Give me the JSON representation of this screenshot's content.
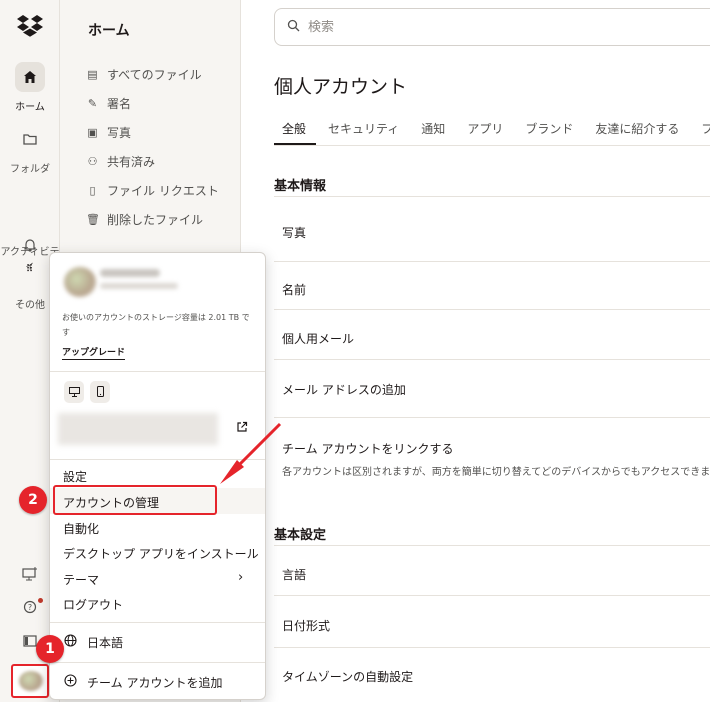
{
  "rail": {
    "items": [
      {
        "label": "ホーム",
        "icon": "home-icon",
        "active": true
      },
      {
        "label": "フォルダ",
        "icon": "folder-icon"
      },
      {
        "label": "アクティビテ\nィ",
        "icon": "bell-icon"
      },
      {
        "label": "その他",
        "icon": "grid-icon"
      }
    ],
    "bottom_icons": [
      "desktop-plus-icon",
      "help-icon",
      "panel-icon"
    ]
  },
  "nav": {
    "title": "ホーム",
    "items": [
      {
        "label": "すべてのファイル",
        "icon": "files-icon"
      },
      {
        "label": "署名",
        "icon": "signature-icon"
      },
      {
        "label": "写真",
        "icon": "photo-icon"
      },
      {
        "label": "共有済み",
        "icon": "shared-icon"
      },
      {
        "label": "ファイル リクエスト",
        "icon": "file-request-icon"
      },
      {
        "label": "削除したファイル",
        "icon": "trash-icon"
      }
    ]
  },
  "search": {
    "placeholder": "検索"
  },
  "page": {
    "title": "個人アカウント",
    "tabs": [
      "全般",
      "セキュリティ",
      "通知",
      "アプリ",
      "ブランド",
      "友達に紹介する",
      "プ"
    ],
    "active_tab": "全般",
    "section_basic": "基本情報",
    "basic_rows": [
      "写真",
      "名前",
      "個人用メール",
      "メール アドレスの追加"
    ],
    "team_link": {
      "label": "チーム アカウントをリンクする",
      "sub": "各アカウントは区別されますが、両方を簡単に切り替えてどのデバイスからでもアクセスできます。"
    },
    "section_prefs": "基本設定",
    "pref_rows": [
      "言語",
      "日付形式",
      "タイムゾーンの自動設定"
    ]
  },
  "menu": {
    "storage_text": "お使いのアカウントのストレージ容量は 2.01 TB で\nす",
    "upgrade": "アップグレード",
    "items": [
      "設定",
      "アカウントの管理",
      "自動化",
      "デスクトップ アプリをインストール",
      "テーマ",
      "ログアウト"
    ],
    "language": "日本語",
    "add_team": "チーム アカウントを追加"
  },
  "annotations": {
    "step1": "1",
    "step2": "2",
    "color": "#e5242b"
  },
  "colors": {
    "sidebar_bg": "#f7f5f2",
    "text": "#1e1919",
    "accent": "#e5242b"
  }
}
